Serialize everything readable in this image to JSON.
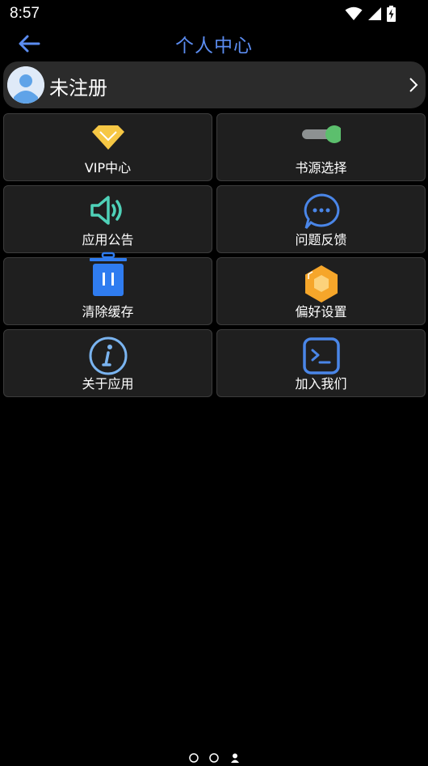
{
  "status_bar": {
    "time": "8:57"
  },
  "header": {
    "title": "个人中心",
    "accent_color": "#5b8cf0"
  },
  "profile": {
    "name": "未注册"
  },
  "menu": [
    {
      "label": "VIP中心",
      "icon": "diamond-icon",
      "color": "#f6c744"
    },
    {
      "label": "书源选择",
      "icon": "toggle-switch-icon",
      "color": "#5cbf6d"
    },
    {
      "label": "应用公告",
      "icon": "speaker-icon",
      "color": "#4fd1b8"
    },
    {
      "label": "问题反馈",
      "icon": "chat-bubble-icon",
      "color": "#4a86e8"
    },
    {
      "label": "清除缓存",
      "icon": "trash-icon",
      "color": "#2f7cf0"
    },
    {
      "label": "偏好设置",
      "icon": "hexagon-settings-icon",
      "color": "#f6a62a"
    },
    {
      "label": "关于应用",
      "icon": "info-icon",
      "color": "#7ab4f0"
    },
    {
      "label": "加入我们",
      "icon": "terminal-icon",
      "color": "#4a86e8"
    }
  ]
}
